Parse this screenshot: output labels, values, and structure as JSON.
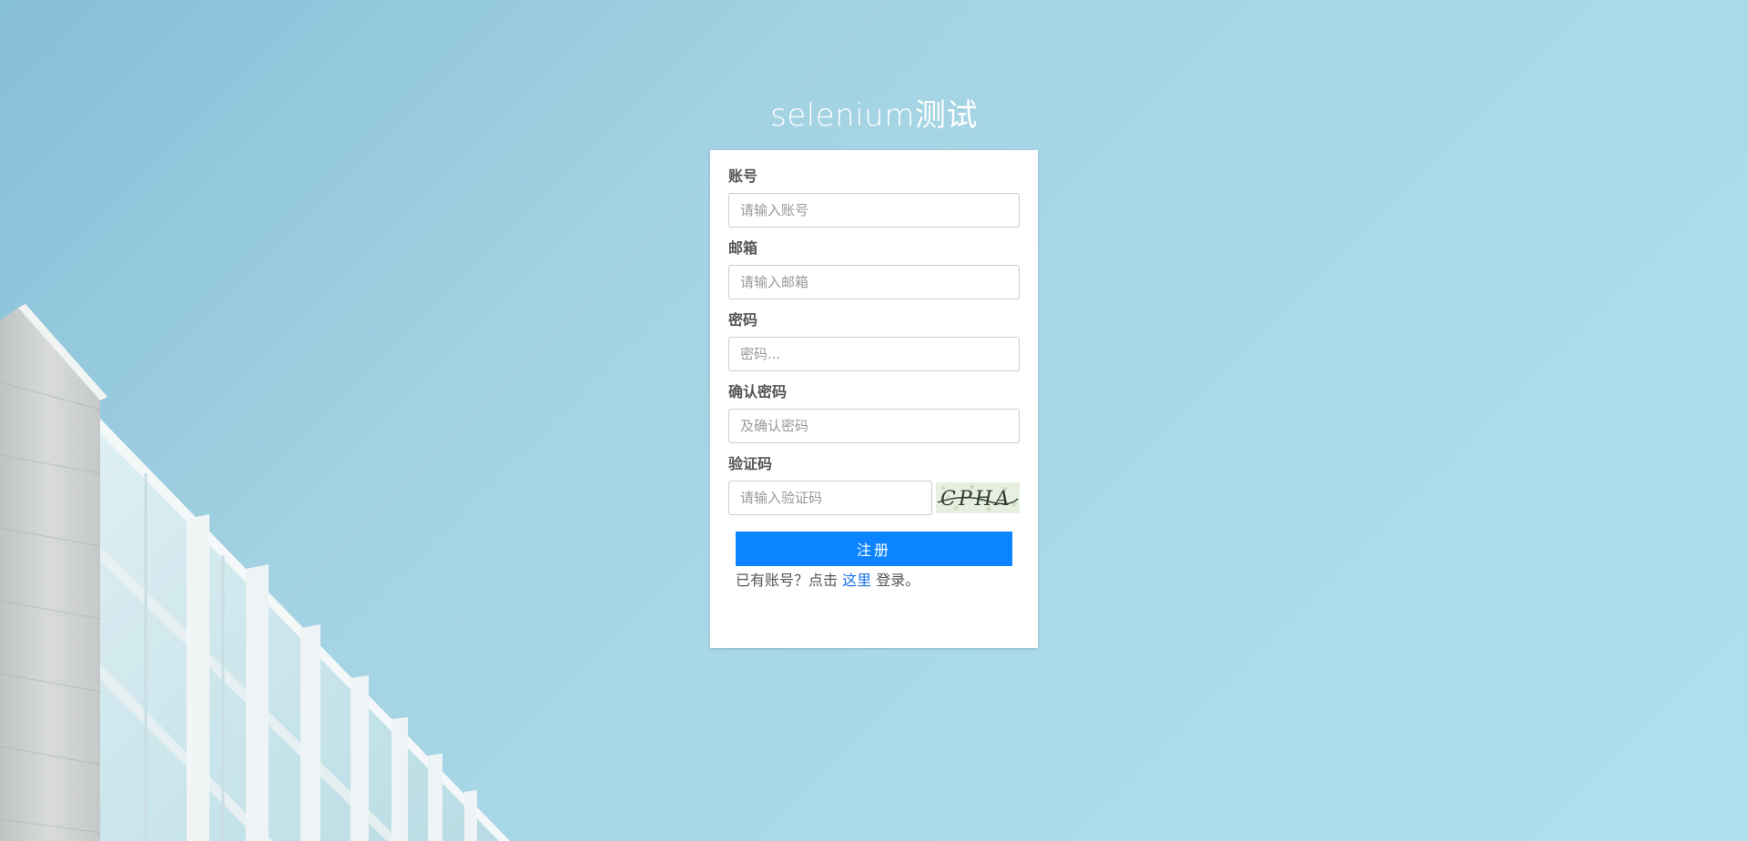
{
  "page": {
    "title": "selenium测试"
  },
  "form": {
    "account": {
      "label": "账号",
      "placeholder": "请输入账号",
      "value": ""
    },
    "email": {
      "label": "邮箱",
      "placeholder": "请输入邮箱",
      "value": ""
    },
    "password": {
      "label": "密码",
      "placeholder": "密码...",
      "value": ""
    },
    "confirm_password": {
      "label": "确认密码",
      "placeholder": "及确认密码",
      "value": ""
    },
    "captcha": {
      "label": "验证码",
      "placeholder": "请输入验证码",
      "value": "",
      "image_text": "CPHA"
    },
    "submit_label": "注册",
    "login_hint": {
      "prefix": "已有账号？点击",
      "link_text": "这里",
      "suffix": "登录。"
    }
  },
  "colors": {
    "primary": "#0d84ff",
    "link": "#1a73e8",
    "label": "#555555",
    "placeholder": "#999999",
    "background_sky": "#a9d9e8"
  },
  "icons": {
    "captcha": "captcha-image",
    "building": "building-illustration"
  }
}
